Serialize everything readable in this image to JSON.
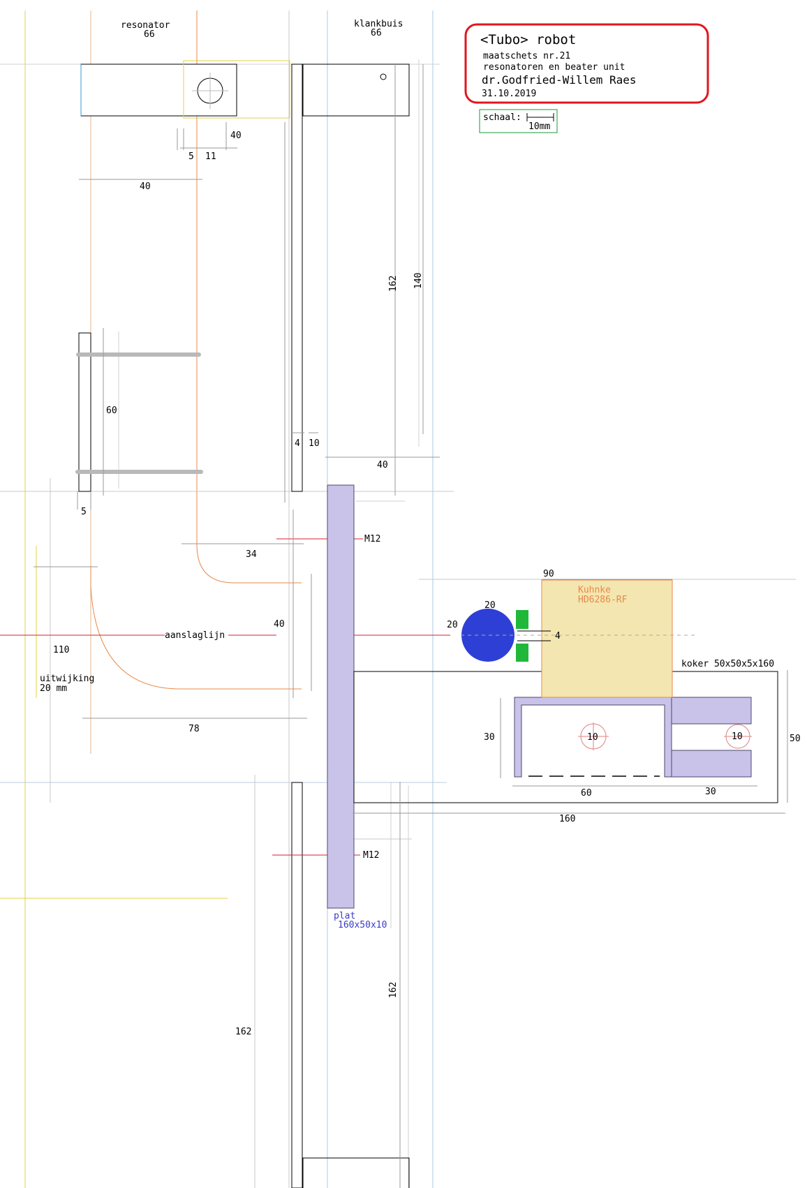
{
  "title_block": {
    "title": "<Tubo> robot",
    "line1": "maatschets  nr.21",
    "line2": "resonatoren en beater unit",
    "author": "dr.Godfried-Willem Raes",
    "date": "31.10.2019",
    "scale_label": "schaal:",
    "scale_value": "10mm",
    "border_color": "#e0161e"
  },
  "labels": {
    "resonator": "resonator",
    "resonator_width": "66",
    "klankbuis": "klankbuis",
    "klankbuis_width": "66",
    "aanslaglijn": "aanslaglijn",
    "uitwijking_1": "uitwijking",
    "uitwijking_2": "20 mm",
    "m12_top": "M12",
    "m12_bottom": "M12",
    "plat_1": "plat",
    "plat_2": "160x50x10",
    "kuhnke_1": "Kuhnke",
    "kuhnke_2": "HD6286-RF",
    "koker": "koker  50x50x5x160"
  },
  "dimensions": {
    "d40_a": "40",
    "d5_a": "5",
    "d11": "11",
    "d40_b": "40",
    "d162_top": "162",
    "d140": "140",
    "d60": "60",
    "d4": "4",
    "d10_a": "10",
    "d40_c": "40",
    "d5_b": "5",
    "d34": "34",
    "d40_d": "40",
    "d110": "110",
    "d78": "78",
    "d90": "90",
    "d20_a": "20",
    "d20_b": "20",
    "d4_b": "4",
    "d30_a": "30",
    "d10_b": "10",
    "d10_c": "10",
    "d50": "50",
    "d60_b": "60",
    "d30_b": "30",
    "d160": "160",
    "d162_mid": "162",
    "d162_low": "162"
  },
  "colors": {
    "plate_fill": "#c9c3ea",
    "kuhnke_fill": "#f3e6b0",
    "beater_blue": "#2e3fd6",
    "green_block": "#1fb83a",
    "orange_line": "#e8894a",
    "red_line": "#d42030",
    "yellow_line": "#e6d040",
    "blue_guide": "#a9c8e6"
  }
}
